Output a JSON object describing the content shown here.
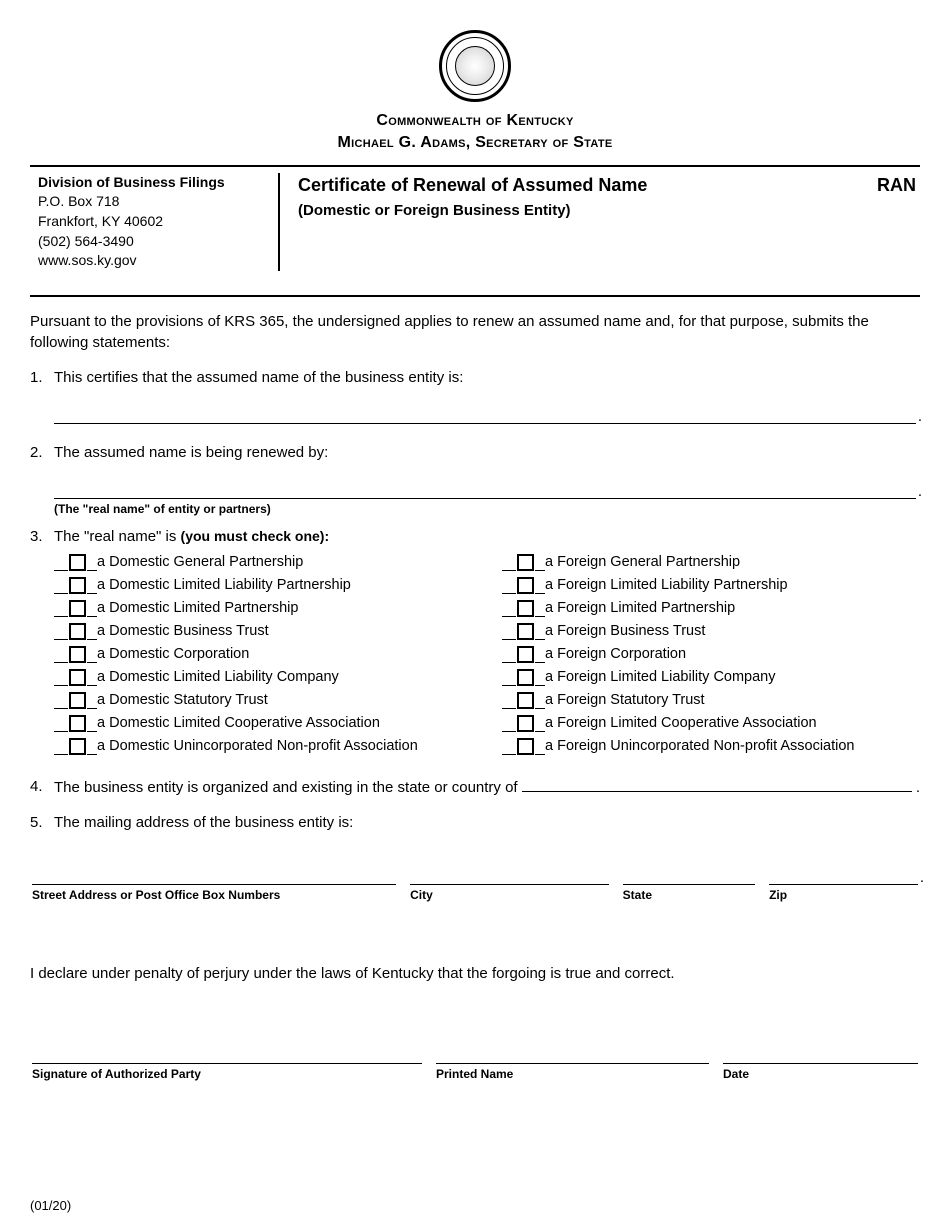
{
  "header": {
    "commonwealth": "Commonwealth of Kentucky",
    "secretary": "Michael G. Adams, Secretary of State"
  },
  "division": {
    "title": "Division of Business Filings",
    "line1": "P.O. Box 718",
    "line2": "Frankfort, KY 40602",
    "phone": "(502) 564-3490",
    "web": "www.sos.ky.gov"
  },
  "form": {
    "title": "Certificate of Renewal of Assumed Name",
    "subtitle": "(Domestic or Foreign Business Entity)",
    "code": "RAN"
  },
  "intro": "Pursuant to the provisions of KRS 365, the undersigned applies to renew an assumed name and, for that purpose, submits the following statements:",
  "items": {
    "n1": "1.",
    "t1": "This certifies that the assumed name of the business entity is:",
    "n2": "2.",
    "t2": "The assumed name is being renewed by:",
    "t2caption": "(The \"real name\" of entity or partners)",
    "n3": "3.",
    "t3a": "The \"real name\" is ",
    "t3b": "(you must check one):",
    "n4": "4.",
    "t4": "The business entity is organized and existing in the state or country of ",
    "n5": "5.",
    "t5": "The mailing address of the business entity is:"
  },
  "checks_left": [
    "a Domestic General Partnership",
    "a Domestic Limited Liability Partnership",
    "a Domestic Limited Partnership",
    "a Domestic Business Trust",
    "a Domestic Corporation",
    "a Domestic Limited Liability Company",
    "a Domestic Statutory Trust",
    "a Domestic Limited Cooperative Association",
    "a Domestic Unincorporated Non-profit Association"
  ],
  "checks_right": [
    "a Foreign General Partnership",
    "a Foreign Limited Liability Partnership",
    "a Foreign Limited Partnership",
    "a Foreign Business Trust",
    "a Foreign Corporation",
    "a Foreign Limited Liability Company",
    "a Foreign Statutory Trust",
    "a Foreign Limited Cooperative Association",
    "a Foreign Unincorporated Non-profit Association"
  ],
  "addr_labels": {
    "street": "Street Address or Post Office Box Numbers",
    "city": "City",
    "state": "State",
    "zip": "Zip"
  },
  "declaration": "I declare under penalty of perjury under the laws of Kentucky that the forgoing is true and correct.",
  "sig_labels": {
    "sig": "Signature of Authorized Party",
    "name": "Printed Name",
    "date": "Date"
  },
  "footer": "(01/20)"
}
